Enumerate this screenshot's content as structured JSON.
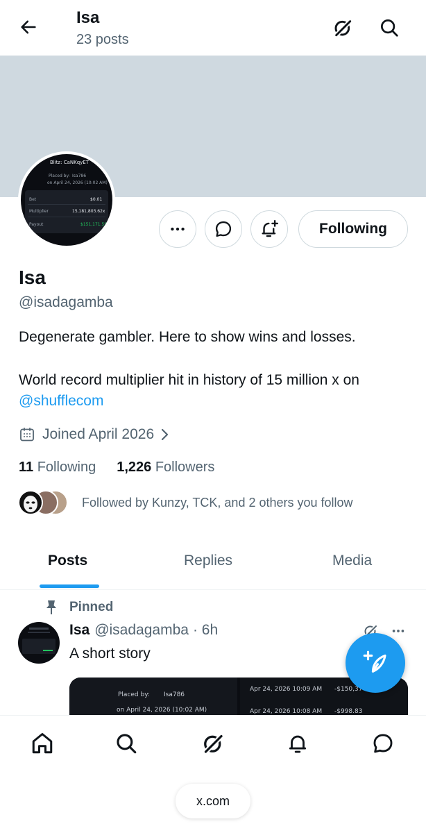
{
  "header": {
    "title": "Isa",
    "post_count": "23 posts",
    "back_icon": "arrow-left-icon",
    "grok_icon": "grok-icon",
    "search_icon": "search-icon"
  },
  "avatar": {
    "screenshot_text": {
      "title": "Blitz: CaNKqyET",
      "placed_by": "Placed by:",
      "user": "Isa786",
      "date": "on April 24, 2026 (10:02 AM)",
      "bet_label": "Bet",
      "bet_value": "$0.01",
      "multiplier_label": "Multiplier",
      "multiplier_value": "15,181,803.62x",
      "payout_label": "Payout",
      "payout_value": "$151,171.59"
    }
  },
  "actions": {
    "more_icon": "more-icon",
    "message_icon": "message-icon",
    "notify_icon": "bell-plus-icon",
    "following_label": "Following"
  },
  "profile": {
    "name": "Isa",
    "handle": "@isadagamba",
    "bio_line1": "Degenerate gambler. Here to show wins and losses.",
    "bio_line2": "World record multiplier hit in history of 15 million x on",
    "bio_mention": "@shufflecom",
    "joined": "Joined April 2026",
    "following_count": "11",
    "following_label": "Following",
    "followers_count": "1,226",
    "followers_label": "Followers",
    "followed_by": "Followed by Kunzy, TCK, and 2 others you follow"
  },
  "tabs": [
    {
      "label": "Posts",
      "active": true
    },
    {
      "label": "Replies",
      "active": false
    },
    {
      "label": "Media",
      "active": false
    }
  ],
  "pinned_post": {
    "pinned_label": "Pinned",
    "author_name": "Isa",
    "author_handle": "@isadagamba",
    "time": "· 6h",
    "text": "A short story",
    "media_left": {
      "placed_by": "Placed by:",
      "user": "Isa786",
      "date": "on April 24, 2026 (10:02 AM)"
    },
    "media_right": {
      "row1_date": "Apr 24, 2026 10:09 AM",
      "row1_amount": "-$150,37",
      "row2_date": "Apr 24, 2026 10:08 AM",
      "row2_amount": "-$998.83"
    }
  },
  "fab": {
    "icon": "compose-post-icon"
  },
  "bottom_nav": {
    "items": [
      "home-icon",
      "search-icon",
      "grok-icon",
      "notifications-icon",
      "messages-icon"
    ],
    "url": "x.com"
  },
  "colors": {
    "accent": "#1d9bf0",
    "banner": "#cfd9e0",
    "secondary_text": "#536471"
  }
}
